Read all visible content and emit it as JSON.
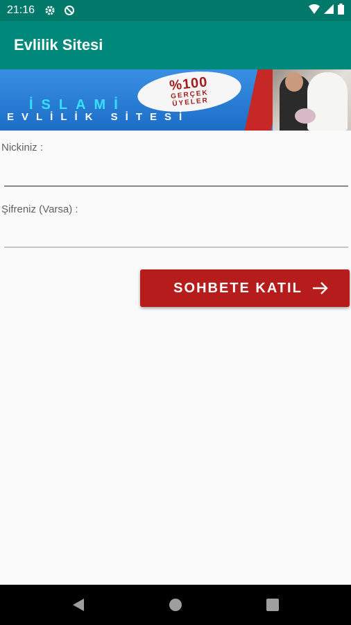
{
  "status_bar": {
    "time": "21:16",
    "icons": [
      "gear-icon",
      "do-not-disturb-icon",
      "wifi-icon",
      "signal-icon",
      "battery-icon"
    ]
  },
  "app_bar": {
    "title": "Evlilik Sitesi",
    "color": "#00897b",
    "status_color": "#00796b"
  },
  "banner": {
    "badge_line1": "%100",
    "badge_line2": "GERÇEK",
    "badge_line3": "ÜYELER",
    "title_line1": "İSLAMİ",
    "title_line2": "EVLİLİK SİTESİ"
  },
  "form": {
    "nick_label": "Nickiniz :",
    "nick_value": "",
    "password_label": "Şifreniz (Varsa) :",
    "password_value": ""
  },
  "join_button": {
    "label": "SOHBETE KATIL",
    "icon": "arrow-right-icon",
    "color": "#b71c1c"
  },
  "nav_bar": {
    "items": [
      "back-icon",
      "home-icon",
      "recents-icon"
    ]
  }
}
